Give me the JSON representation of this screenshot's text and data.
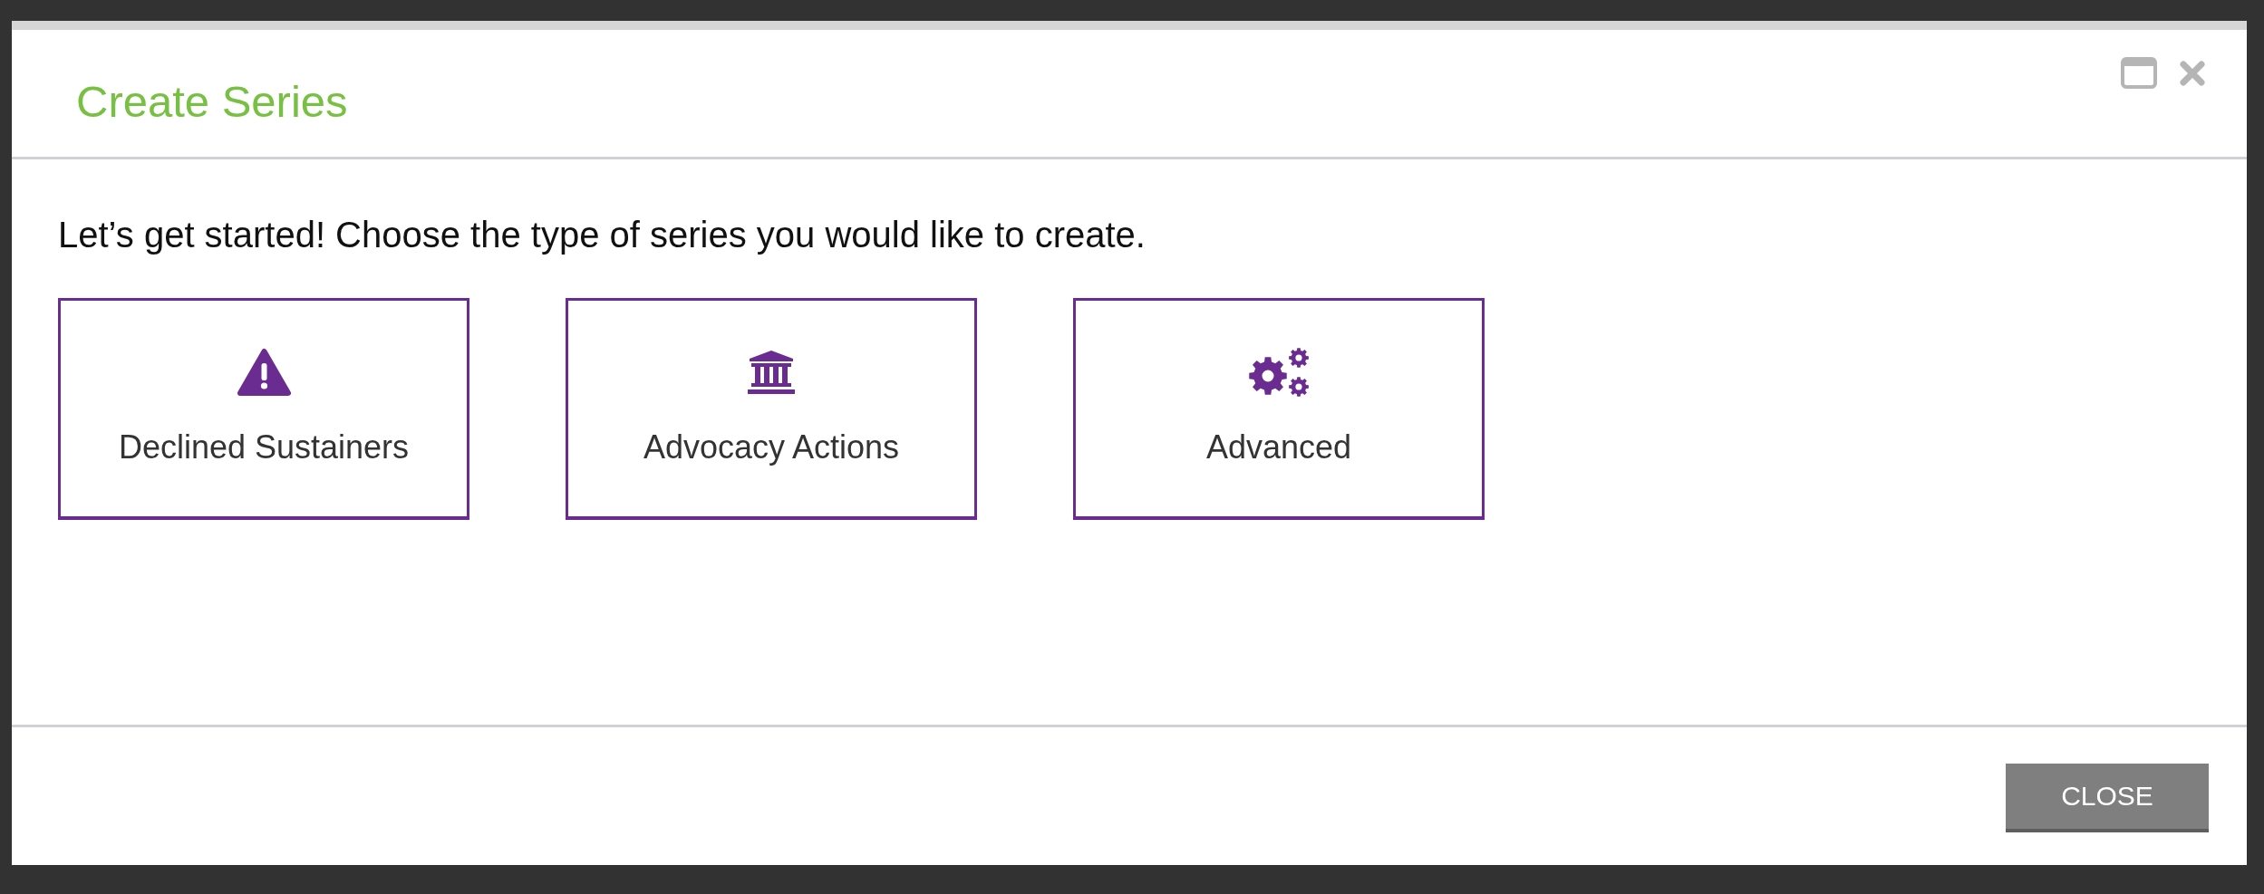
{
  "dialog": {
    "title": "Create Series"
  },
  "intro": "Let’s get started! Choose the type of series you would like to create.",
  "series_types": [
    {
      "label": "Declined Sustainers"
    },
    {
      "label": "Advocacy Actions"
    },
    {
      "label": "Advanced"
    }
  ],
  "footer": {
    "buttons": [
      "CLOSE"
    ]
  }
}
